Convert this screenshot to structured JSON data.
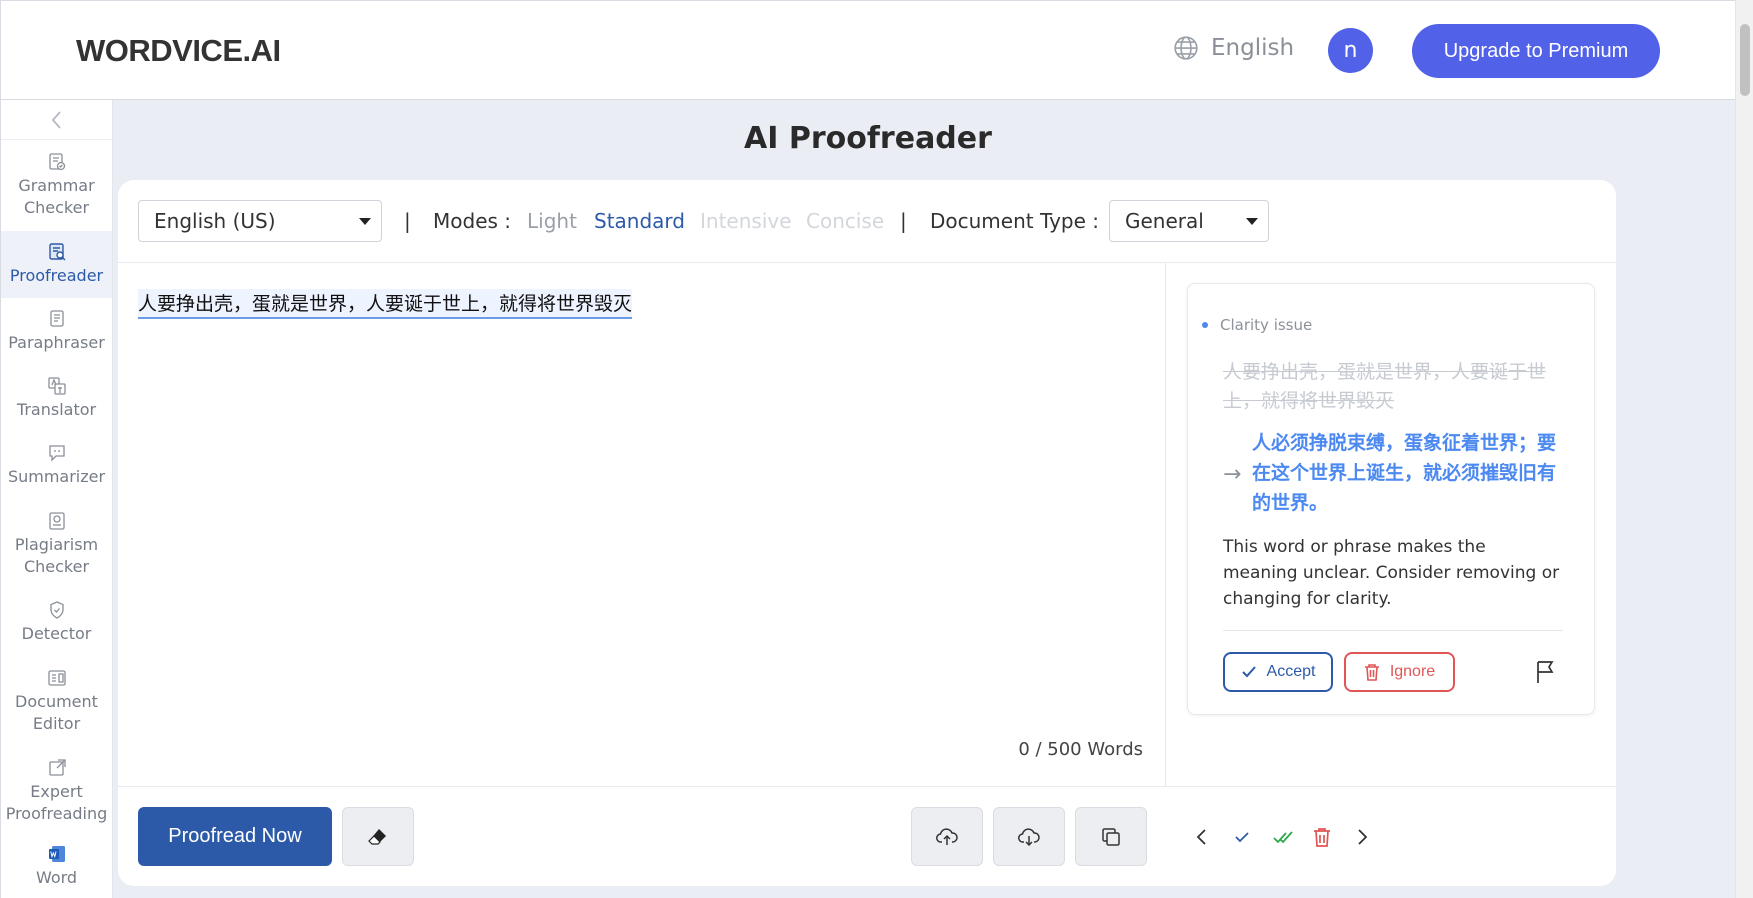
{
  "header": {
    "logo": "WORDVICE.AI",
    "language": "English",
    "avatar_initial": "n",
    "upgrade_label": "Upgrade to Premium"
  },
  "sidebar": {
    "items": [
      {
        "label": "Grammar Checker",
        "icon": "grammar-check-icon",
        "active": false
      },
      {
        "label": "Proofreader",
        "icon": "proofreader-icon",
        "active": true
      },
      {
        "label": "Paraphraser",
        "icon": "paraphraser-icon",
        "active": false
      },
      {
        "label": "Translator",
        "icon": "translator-icon",
        "active": false
      },
      {
        "label": "Summarizer",
        "icon": "summarizer-icon",
        "active": false
      },
      {
        "label": "Plagiarism Checker",
        "icon": "plagiarism-icon",
        "active": false
      },
      {
        "label": "Detector",
        "icon": "detector-icon",
        "active": false
      },
      {
        "label": "Document Editor",
        "icon": "document-editor-icon",
        "active": false
      },
      {
        "label": "Expert Proofreading",
        "icon": "expert-proofreading-icon",
        "active": false
      },
      {
        "label": "Word",
        "icon": "word-icon",
        "active": false
      }
    ]
  },
  "main": {
    "title": "AI Proofreader",
    "language_select": "English (US)",
    "separator": "|",
    "modes_label": "Modes :",
    "modes": [
      {
        "label": "Light",
        "state": "available"
      },
      {
        "label": "Standard",
        "state": "selected"
      },
      {
        "label": "Intensive",
        "state": "disabled"
      },
      {
        "label": "Concise",
        "state": "disabled"
      }
    ],
    "doc_type_label": "Document Type :",
    "doc_type_select": "General",
    "editor_text": "人要挣出壳，蛋就是世界，人要诞于世上，就得将世界毁灭",
    "word_count": "0 / 500 Words",
    "proofread_label": "Proofread Now"
  },
  "suggestion": {
    "issue_type": "Clarity issue",
    "original": "人要挣出壳，蛋就是世界，人要诞于世上，就得将世界毁灭",
    "replacement": "人必须挣脱束缚，蛋象征着世界；要在这个世界上诞生，就必须摧毁旧有的世界。",
    "explanation": "This word or phrase makes the meaning unclear. Consider removing or changing for clarity.",
    "accept_label": "Accept",
    "ignore_label": "Ignore"
  },
  "colors": {
    "brand": "#5161e8",
    "primary": "#2d5aa8",
    "suggestion": "#4c89f0",
    "danger": "#e05656",
    "accept_all": "#2aa84a"
  }
}
